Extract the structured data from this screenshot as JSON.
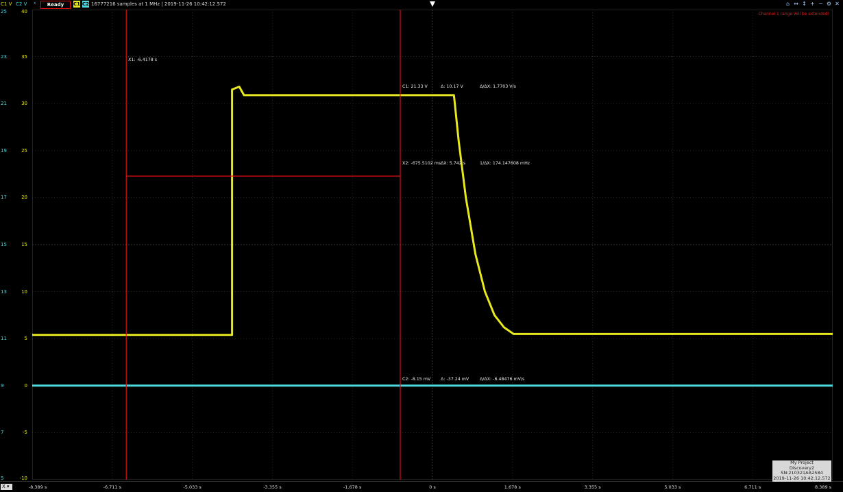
{
  "topbar": {
    "ch1_scale_label": "C1 V",
    "ch2_scale_label": "C2 V",
    "back_icon": "chevron-left-icon",
    "status": "Ready",
    "c1_button": "C1",
    "c2_button": "C2",
    "info": "16777216 samples at 1 MHz | 2019-11-26 10:42:12.572",
    "toolbar_icons": [
      "zoom-fit-icon",
      "zoom-x-icon",
      "zoom-y-icon",
      "zoom-in-icon",
      "zoom-out-icon",
      "settings-icon",
      "close-icon"
    ],
    "channel_warning": "Channel 1 range will be extended!"
  },
  "colors": {
    "c1": "#e8e820",
    "c2": "#4fd8e0",
    "cursor": "#e01010",
    "grid": "#3a3a3a"
  },
  "scales": {
    "c2": [
      "25",
      "23",
      "21",
      "19",
      "17",
      "15",
      "13",
      "11",
      "9",
      "7",
      "5"
    ],
    "c1": [
      "40",
      "35",
      "30",
      "25",
      "20",
      "15",
      "10",
      "5",
      "0",
      "-5",
      "-10"
    ]
  },
  "cursors": {
    "x1_label": "X1: -6.4178 s",
    "x2_label": "X2: -675.5102 ms",
    "dx_label": "ΔX: 5.742 s",
    "inv_dx_label": "1/ΔX: 174.147608 mHz",
    "c1_value": "C1: 21.33 V",
    "c1_delta": "Δ: 10.17 V",
    "c1_rate": "Δ/ΔX: 1.7703 V/s",
    "c2_value": "C2: -8.15 mV",
    "c2_delta": "Δ: -37.24 mV",
    "c2_rate": "Δ/ΔX: -6.48476 mV/s"
  },
  "x_axis": {
    "menu": "X",
    "ticks": [
      "-8.389 s",
      "-6.711 s",
      "-5.033 s",
      "-3.355 s",
      "-1.678 s",
      "0 s",
      "1.678 s",
      "3.355 s",
      "5.033 s",
      "6.711 s",
      "8.389 s"
    ]
  },
  "device_box": {
    "project": "My Project",
    "device": "Discovery2",
    "serial": "SN:210321AA2584",
    "timestamp": "2019-11-26 10:42:12.572"
  },
  "chart_data": {
    "type": "line",
    "xlabel": "",
    "ylabel": "",
    "xlim": [
      -8.389,
      8.389
    ],
    "ylim_c1": [
      -10,
      40
    ],
    "series": [
      {
        "name": "C1",
        "x": [
          -8.389,
          -4.2,
          -4.2,
          -4.05,
          -3.95,
          0.45,
          0.55,
          0.7,
          0.9,
          1.1,
          1.3,
          1.5,
          1.7,
          8.389
        ],
        "y": [
          5.4,
          5.4,
          31.5,
          31.8,
          30.9,
          30.9,
          26,
          20,
          14,
          10,
          7.5,
          6.2,
          5.5,
          5.5
        ]
      },
      {
        "name": "C2",
        "x": [
          -8.389,
          8.389
        ],
        "y": [
          0,
          0
        ]
      }
    ],
    "cursors_x": [
      -6.4178,
      -0.6755
    ]
  }
}
